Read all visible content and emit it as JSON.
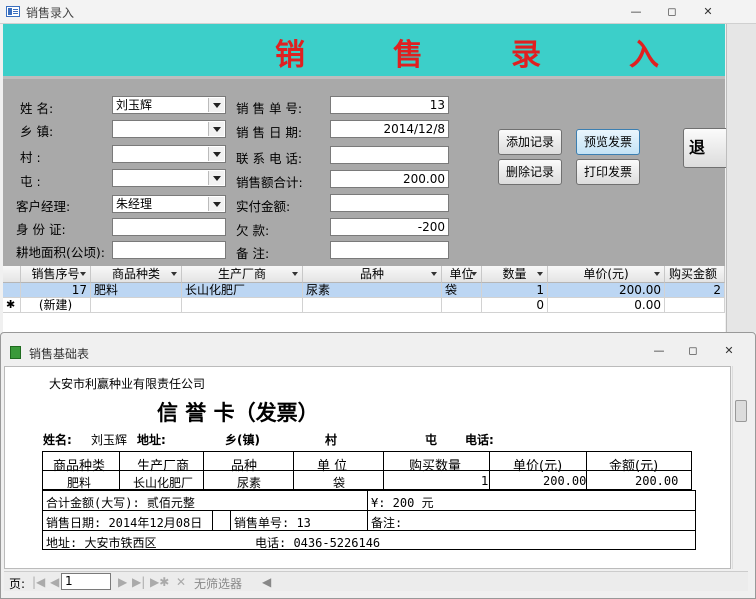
{
  "window": {
    "title": "销售录入",
    "minimize": "—",
    "restore": "◻",
    "close": "✕"
  },
  "banner": {
    "chars": [
      "销",
      "售",
      "录",
      "入"
    ]
  },
  "form": {
    "labels": {
      "name": "姓    名:",
      "township": "乡    镇:",
      "village": "村         :",
      "tun": "屯         :",
      "manager": "客户经理:",
      "idcard": "身 份 证:",
      "area": "耕地面积(公顷):",
      "order_no": "销 售 单 号:",
      "date": "销 售 日 期:",
      "phone": "联 系 电 话:",
      "total": "销售额合计:",
      "paid": "实付金额:",
      "owed": "欠        款:",
      "remark": "备        注:"
    },
    "values": {
      "name": "刘玉辉",
      "township": "",
      "village": "",
      "tun": "",
      "manager": "朱经理",
      "idcard": "",
      "area": "",
      "order_no": "13",
      "date": "2014/12/8",
      "phone": "",
      "total": "200.00",
      "paid": "",
      "owed": "-200",
      "remark": ""
    },
    "buttons": {
      "add": "添加记录",
      "preview": "预览发票",
      "delete": "删除记录",
      "print": "打印发票",
      "exit": "退"
    }
  },
  "grid": {
    "headers": [
      "销售序号",
      "商品种类",
      "生产厂商",
      "品种",
      "单位",
      "数量",
      "单价(元)",
      "购买金额"
    ],
    "rows": [
      [
        "17",
        "肥料",
        "长山化肥厂",
        "尿素",
        "袋",
        "1",
        "200.00",
        "2"
      ],
      [
        "(新建)",
        "",
        "",
        "",
        "",
        "0",
        "0.00",
        ""
      ]
    ],
    "new_marker": "✱"
  },
  "report": {
    "title": "销售基础表",
    "company": "大安市利赢种业有限责任公司",
    "heading": "信    誉    卡（发票）",
    "customer_label": "姓名:",
    "customer": "刘玉辉",
    "address_label": "地址:",
    "township_label": "乡(镇)",
    "village_label": "村",
    "tun_label": "屯",
    "phone_label": "电话:",
    "table_headers": [
      "商品种类",
      "生产厂商",
      "品种",
      "单  位",
      "购买数量",
      "单价(元)",
      "金额(元)"
    ],
    "table_row": [
      "肥料",
      "长山化肥厂",
      "尿素",
      "袋",
      "1",
      "200.00",
      "200.00"
    ],
    "total_caps": "合计金额(大写): 贰佰元整",
    "total_num": "¥: 200 元",
    "sale_date": "销售日期: 2014年12月08日",
    "sale_no": "销售单号: 13",
    "remark": "备注:",
    "address": "地址: 大安市铁西区",
    "tel": "电话: 0436-5226146"
  },
  "statusbar": {
    "page_label": "页:",
    "page_value": "1",
    "filter": "无筛选器"
  }
}
